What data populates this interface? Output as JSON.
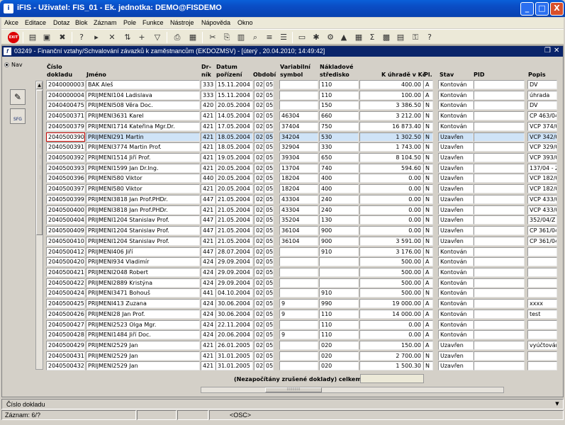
{
  "app": {
    "title": "iFIS - Uživatel: FIS_01 - Ek. jednotka: DEMO@FISDEMO",
    "icon_label": "i",
    "window_controls": [
      "_",
      "□",
      "X"
    ]
  },
  "menu": [
    "Akce",
    "Editace",
    "Dotaz",
    "Blok",
    "Záznam",
    "Pole",
    "Funkce",
    "Nástroje",
    "Nápověda",
    "Okno"
  ],
  "toolbar": {
    "exit_label": "EXIT",
    "icons": [
      "save-icon",
      "print-icon",
      "delete-icon",
      "filter-icon",
      "query-icon",
      "run-icon",
      "funnel-icon",
      "printer-icon",
      "preview-icon",
      "scissors-icon",
      "copy-icon",
      "paste-icon",
      "find-icon",
      "list-icon",
      "lov-icon",
      "folder-icon",
      "tool-icon",
      "chart-icon",
      "sum-icon",
      "excel-icon",
      "export-icon",
      "key-icon",
      "help-icon"
    ]
  },
  "form": {
    "title": "03249 - Finanční vztahy/Schvalování závazků k zaměstnancům (EKDOZMSV) - [úterý  , 20.04.2010; 14:49:42]",
    "nav_label": "Nav",
    "sfg_label": "SFG"
  },
  "headers": {
    "doc_l1": "Číslo",
    "doc_l2": "dokladu",
    "name": "Jméno",
    "druh_l1": "Dr-",
    "druh_l2": "ník",
    "date_l1": "Datum",
    "date_l2": "pořízení",
    "period": "Období",
    "vs_l1": "Variabilní",
    "vs_l2": "symbol",
    "cost_l1": "Nákladové",
    "cost_l2": "středisko",
    "amount": "K úhradě v Kč",
    "pl": "Pl.",
    "state": "Stav",
    "pid": "PID",
    "desc": "Popis"
  },
  "rows": [
    {
      "doc": "2040000003",
      "name": "BAK Aleš",
      "druh": "333",
      "date": "15.11.2004",
      "p1": "02",
      "p2": "05",
      "vs": "",
      "cost": "110",
      "amount": "400.00",
      "pl": "A",
      "state": "Kontován",
      "pid": "",
      "desc": "DV"
    },
    {
      "doc": "2040000004",
      "name": "PRIJMENI104 Ladislava",
      "druh": "333",
      "date": "15.11.2004",
      "p1": "02",
      "p2": "05",
      "vs": "",
      "cost": "110",
      "amount": "100.00",
      "pl": "A",
      "state": "Kontován",
      "pid": "",
      "desc": "úhrada"
    },
    {
      "doc": "2040400475",
      "name": "PRIJMENI508 Věra Doc.",
      "druh": "420",
      "date": "20.05.2004",
      "p1": "02",
      "p2": "05",
      "vs": "",
      "cost": "150",
      "amount": "3 386.50",
      "pl": "N",
      "state": "Kontován",
      "pid": "",
      "desc": "DV"
    },
    {
      "doc": "2040500371",
      "name": "PRIJMENI3631 Karel",
      "druh": "421",
      "date": "14.05.2004",
      "p1": "02",
      "p2": "05",
      "vs": "46304",
      "cost": "660",
      "amount": "3 212.00",
      "pl": "N",
      "state": "Kontován",
      "pid": "",
      "desc": "CP 463/04"
    },
    {
      "doc": "2040500379",
      "name": "PRIJMENI1714 Kateřina Mgr.Dr.",
      "druh": "421",
      "date": "17.05.2004",
      "p1": "02",
      "p2": "05",
      "vs": "37404",
      "cost": "750",
      "amount": "16 873.40",
      "pl": "N",
      "state": "Kontován",
      "pid": "",
      "desc": "VCP 374/0"
    },
    {
      "doc": "2040500390",
      "name": "PRIJMENI291 Martin",
      "druh": "421",
      "date": "18.05.2004",
      "p1": "02",
      "p2": "05",
      "vs": "34204",
      "cost": "530",
      "amount": "1 302.50",
      "pl": "N",
      "state": "Uzavřen",
      "pid": "",
      "desc": "VCP 342/0"
    },
    {
      "doc": "2040500391",
      "name": "PRIJMENI3774 Martin Prof.",
      "druh": "421",
      "date": "18.05.2004",
      "p1": "02",
      "p2": "05",
      "vs": "32904",
      "cost": "330",
      "amount": "1 743.00",
      "pl": "N",
      "state": "Uzavřen",
      "pid": "",
      "desc": "VCP 329/0"
    },
    {
      "doc": "2040500392",
      "name": "PRIJMENI1514 Jiří Prof.",
      "druh": "421",
      "date": "19.05.2004",
      "p1": "02",
      "p2": "05",
      "vs": "39304",
      "cost": "650",
      "amount": "8 104.50",
      "pl": "N",
      "state": "Uzavřen",
      "pid": "",
      "desc": "VCP 393/0"
    },
    {
      "doc": "2040500393",
      "name": "PRIJMENI1599 Jan Dr.Ing.",
      "druh": "421",
      "date": "20.05.2004",
      "p1": "02",
      "p2": "05",
      "vs": "13704",
      "cost": "740",
      "amount": "594.60",
      "pl": "N",
      "state": "Uzavřen",
      "pid": "",
      "desc": "137/04 - Ž"
    },
    {
      "doc": "2040500396",
      "name": "PRIJMENI580 Viktor",
      "druh": "440",
      "date": "20.05.2004",
      "p1": "02",
      "p2": "05",
      "vs": "18204",
      "cost": "400",
      "amount": "0.00",
      "pl": "N",
      "state": "Uzavřen",
      "pid": "",
      "desc": "VCP 182/0"
    },
    {
      "doc": "2040500397",
      "name": "PRIJMENI580 Viktor",
      "druh": "421",
      "date": "20.05.2004",
      "p1": "02",
      "p2": "05",
      "vs": "18204",
      "cost": "400",
      "amount": "0.00",
      "pl": "N",
      "state": "Uzavřen",
      "pid": "",
      "desc": "VCP 182/0"
    },
    {
      "doc": "2040500399",
      "name": "PRIJMENI3818 Jan Prof.PHDr.",
      "druh": "447",
      "date": "21.05.2004",
      "p1": "02",
      "p2": "05",
      "vs": "43304",
      "cost": "240",
      "amount": "0.00",
      "pl": "N",
      "state": "Uzavřen",
      "pid": "",
      "desc": "VCP 433/0"
    },
    {
      "doc": "2040500400",
      "name": "PRIJMENI3818 Jan Prof.PHDr.",
      "druh": "421",
      "date": "21.05.2004",
      "p1": "02",
      "p2": "05",
      "vs": "43304",
      "cost": "240",
      "amount": "0.00",
      "pl": "N",
      "state": "Uzavřen",
      "pid": "",
      "desc": "VCP 433/0"
    },
    {
      "doc": "2040500404",
      "name": "PRIJMENI1204 Stanislav Prof.",
      "druh": "447",
      "date": "21.05.2004",
      "p1": "02",
      "p2": "05",
      "vs": "35204",
      "cost": "130",
      "amount": "0.00",
      "pl": "N",
      "state": "Uzavřen",
      "pid": "",
      "desc": "352/04/Z E"
    },
    {
      "doc": "2040500409",
      "name": "PRIJMENI1204 Stanislav Prof.",
      "druh": "447",
      "date": "21.05.2004",
      "p1": "02",
      "p2": "05",
      "vs": "36104",
      "cost": "900",
      "amount": "0.00",
      "pl": "N",
      "state": "Uzavřen",
      "pid": "",
      "desc": "CP 361/04"
    },
    {
      "doc": "2040500410",
      "name": "PRIJMENI1204 Stanislav Prof.",
      "druh": "421",
      "date": "21.05.2004",
      "p1": "02",
      "p2": "05",
      "vs": "36104",
      "cost": "900",
      "amount": "3 591.00",
      "pl": "N",
      "state": "Uzavřen",
      "pid": "",
      "desc": "CP 361/04"
    },
    {
      "doc": "2040500412",
      "name": "PRIJMENI406 Jiří",
      "druh": "447",
      "date": "28.07.2004",
      "p1": "02",
      "p2": "05",
      "vs": "",
      "cost": "910",
      "amount": "3 176.00",
      "pl": "N",
      "state": "Kontován",
      "pid": "",
      "desc": ""
    },
    {
      "doc": "2040500420",
      "name": "PRIJMENI934 Vladimír",
      "druh": "424",
      "date": "29.09.2004",
      "p1": "02",
      "p2": "05",
      "vs": "",
      "cost": "",
      "amount": "500.00",
      "pl": "A",
      "state": "Kontován",
      "pid": "",
      "desc": ""
    },
    {
      "doc": "2040500421",
      "name": "PRIJMENI2048 Robert",
      "druh": "424",
      "date": "29.09.2004",
      "p1": "02",
      "p2": "05",
      "vs": "",
      "cost": "",
      "amount": "500.00",
      "pl": "A",
      "state": "Kontován",
      "pid": "",
      "desc": ""
    },
    {
      "doc": "2040500422",
      "name": "PRIJMENI2889 Kristýna",
      "druh": "424",
      "date": "29.09.2004",
      "p1": "02",
      "p2": "05",
      "vs": "",
      "cost": "",
      "amount": "500.00",
      "pl": "A",
      "state": "Kontován",
      "pid": "",
      "desc": ""
    },
    {
      "doc": "2040500424",
      "name": "PRIJMENI3471 Bohouš",
      "druh": "441",
      "date": "04.10.2004",
      "p1": "02",
      "p2": "05",
      "vs": "",
      "cost": "910",
      "amount": "500.00",
      "pl": "N",
      "state": "Kontován",
      "pid": "",
      "desc": ""
    },
    {
      "doc": "2040500425",
      "name": "PRIJMENI413 Zuzana",
      "druh": "424",
      "date": "30.06.2004",
      "p1": "02",
      "p2": "05",
      "vs": "9",
      "cost": "990",
      "amount": "19 000.00",
      "pl": "A",
      "state": "Kontován",
      "pid": "",
      "desc": "xxxx"
    },
    {
      "doc": "2040500426",
      "name": "PRIJMENI28 Jan Prof.",
      "druh": "424",
      "date": "30.06.2004",
      "p1": "02",
      "p2": "05",
      "vs": "9",
      "cost": "110",
      "amount": "14 000.00",
      "pl": "A",
      "state": "Kontován",
      "pid": "",
      "desc": "test"
    },
    {
      "doc": "2040500427",
      "name": "PRIJMENI2523 Olga Mgr.",
      "druh": "424",
      "date": "22.11.2004",
      "p1": "02",
      "p2": "05",
      "vs": "",
      "cost": "110",
      "amount": "0.00",
      "pl": "A",
      "state": "Kontován",
      "pid": "",
      "desc": ""
    },
    {
      "doc": "2040500428",
      "name": "PRIJMENI1484 Jiří Doc.",
      "druh": "424",
      "date": "20.06.2004",
      "p1": "02",
      "p2": "05",
      "vs": "9",
      "cost": "110",
      "amount": "0.00",
      "pl": "A",
      "state": "Kontován",
      "pid": "",
      "desc": ""
    },
    {
      "doc": "2040500429",
      "name": "PRIJMENI2529 Jan",
      "druh": "421",
      "date": "26.01.2005",
      "p1": "02",
      "p2": "05",
      "vs": "",
      "cost": "020",
      "amount": "150.00",
      "pl": "A",
      "state": "Uzavřen",
      "pid": "",
      "desc": "vyúčtován"
    },
    {
      "doc": "2040500431",
      "name": "PRIJMENI2529 Jan",
      "druh": "421",
      "date": "31.01.2005",
      "p1": "02",
      "p2": "05",
      "vs": "",
      "cost": "020",
      "amount": "2 700.00",
      "pl": "N",
      "state": "Uzavřen",
      "pid": "",
      "desc": ""
    },
    {
      "doc": "2040500432",
      "name": "PRIJMENI2529 Jan",
      "druh": "421",
      "date": "31.01.2005",
      "p1": "02",
      "p2": "05",
      "vs": "",
      "cost": "020",
      "amount": "1 500.30",
      "pl": "N",
      "state": "Uzavřen",
      "pid": "",
      "desc": ""
    }
  ],
  "selected_row": 5,
  "total_label": "(Nezapočítány zrušené doklady) celkem",
  "total_value": "",
  "status": {
    "field_hint": "Číslo dokladu",
    "record": "Záznam: 6/?",
    "mode": "<OSC>"
  },
  "colors": {
    "selection": "#cfe3f7",
    "focus_border": "#c00000",
    "title_blue": "#0a5fd8"
  }
}
